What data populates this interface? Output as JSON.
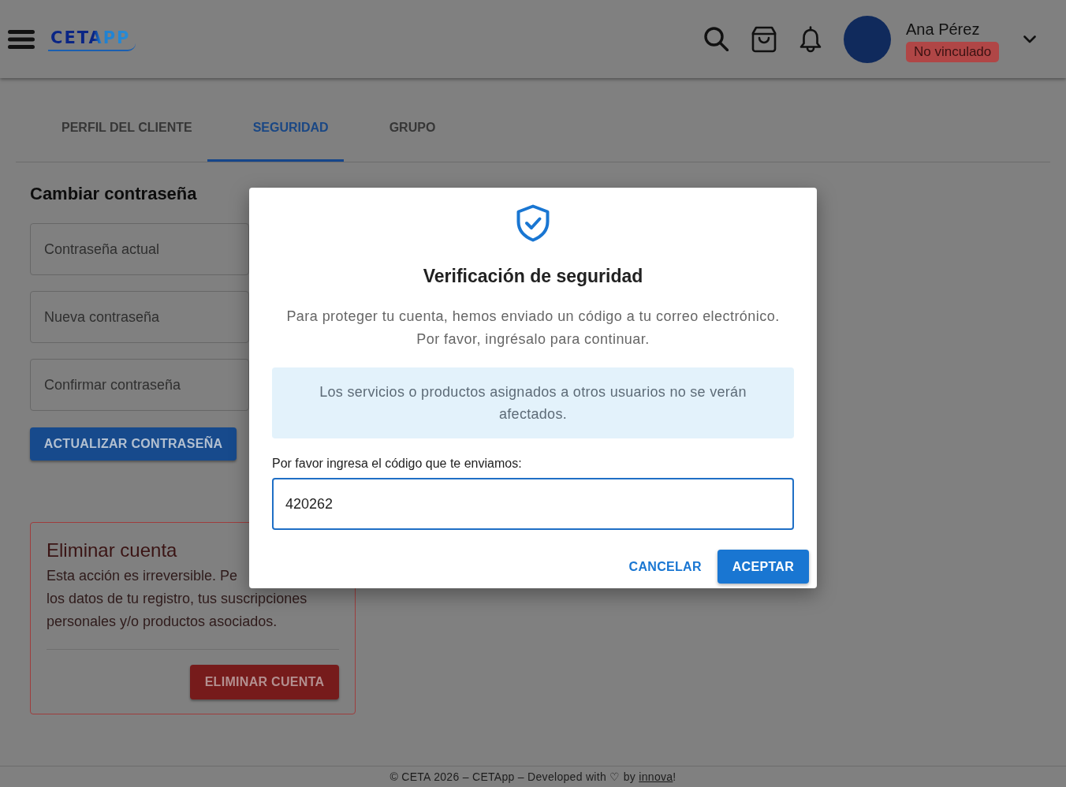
{
  "header": {
    "logo": "CETAPP",
    "user": {
      "name": "Ana Pérez",
      "status": "No vinculado"
    }
  },
  "tabs": [
    {
      "label": "PERFIL DEL CLIENTE",
      "selected": false
    },
    {
      "label": "SEGURIDAD",
      "selected": true
    },
    {
      "label": "GRUPO",
      "selected": false
    }
  ],
  "change_password": {
    "title": "Cambiar contraseña",
    "fields": [
      {
        "placeholder": "Contraseña actual"
      },
      {
        "placeholder": "Nueva contraseña"
      },
      {
        "placeholder": "Confirmar contraseña"
      }
    ],
    "button": "ACTUALIZAR CONTRASEÑA"
  },
  "delete_account": {
    "title": "Eliminar cuenta",
    "lines": [
      "Esta acción es irreversible. Pe",
      "los datos de tu registro, tus suscripciones",
      "personales y/o productos asociados."
    ],
    "button": "ELIMINAR CUENTA"
  },
  "dialog": {
    "title": "Verificación de seguridad",
    "message": "Para proteger tu cuenta, hemos enviado un código a tu correo electrónico. Por favor, ingrésalo para continuar.",
    "notice": "Los servicios o productos asignados a otros usuarios no se verán afectados.",
    "code_field": {
      "label": "Por favor ingresa el código que te enviamos:",
      "value": "420262"
    },
    "buttons": [
      {
        "label": "CANCELAR",
        "kind": "text"
      },
      {
        "label": "ACEPTAR",
        "kind": "primary"
      }
    ]
  },
  "footer": {
    "text_before": "© CETA 2026 – CETApp – Developed with ♡ by ",
    "link": "innova",
    "text_after": "!"
  }
}
